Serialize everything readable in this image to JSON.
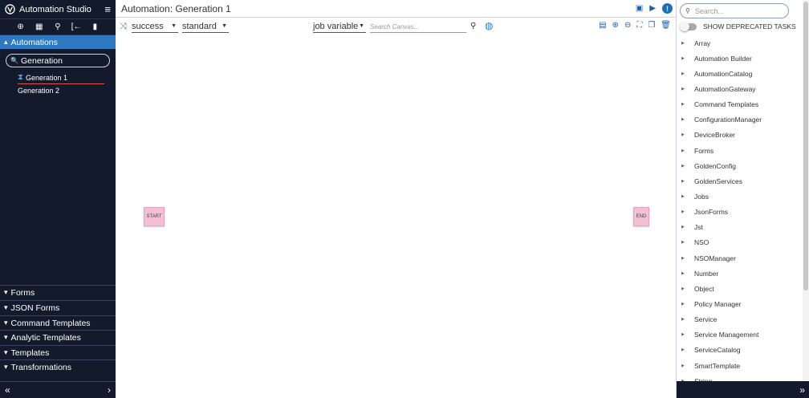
{
  "sidebar": {
    "brand": "Automation Studio",
    "menu_icon": "hamburger-icon",
    "icons": [
      "add-icon",
      "grid-icon",
      "search-icon",
      "import-icon",
      "document-icon"
    ],
    "active_section": "Automations",
    "search_value": "Generation",
    "items": [
      {
        "label": "Generation 1"
      },
      {
        "label": "Generation 2"
      }
    ],
    "collapsed_sections": [
      "Forms",
      "JSON Forms",
      "Command Templates",
      "Analytic Templates",
      "Templates",
      "Transformations"
    ],
    "footer_left": "«",
    "footer_right": "›"
  },
  "main": {
    "title": "Automation: Generation 1",
    "toolbar": {
      "status": "success",
      "mode": "standard",
      "variable": "job variable",
      "search_placeholder": "Search Canvas..."
    },
    "nodes": {
      "start": "START",
      "end": "END"
    }
  },
  "right_panel": {
    "search_placeholder": "Search...",
    "toggle_label": "SHOW DEPRECATED TASKS",
    "tasks": [
      "Array",
      "Automation Builder",
      "AutomationCatalog",
      "AutomationGateway",
      "Command Templates",
      "ConfigurationManager",
      "DeviceBroker",
      "Forms",
      "GoldenConfig",
      "GoldenServices",
      "Jobs",
      "JsonForms",
      "Jst",
      "NSO",
      "NSOManager",
      "Number",
      "Object",
      "Policy Manager",
      "Service",
      "Service Management",
      "ServiceCatalog",
      "SmartTemplate",
      "String"
    ],
    "footer_right": "»"
  }
}
